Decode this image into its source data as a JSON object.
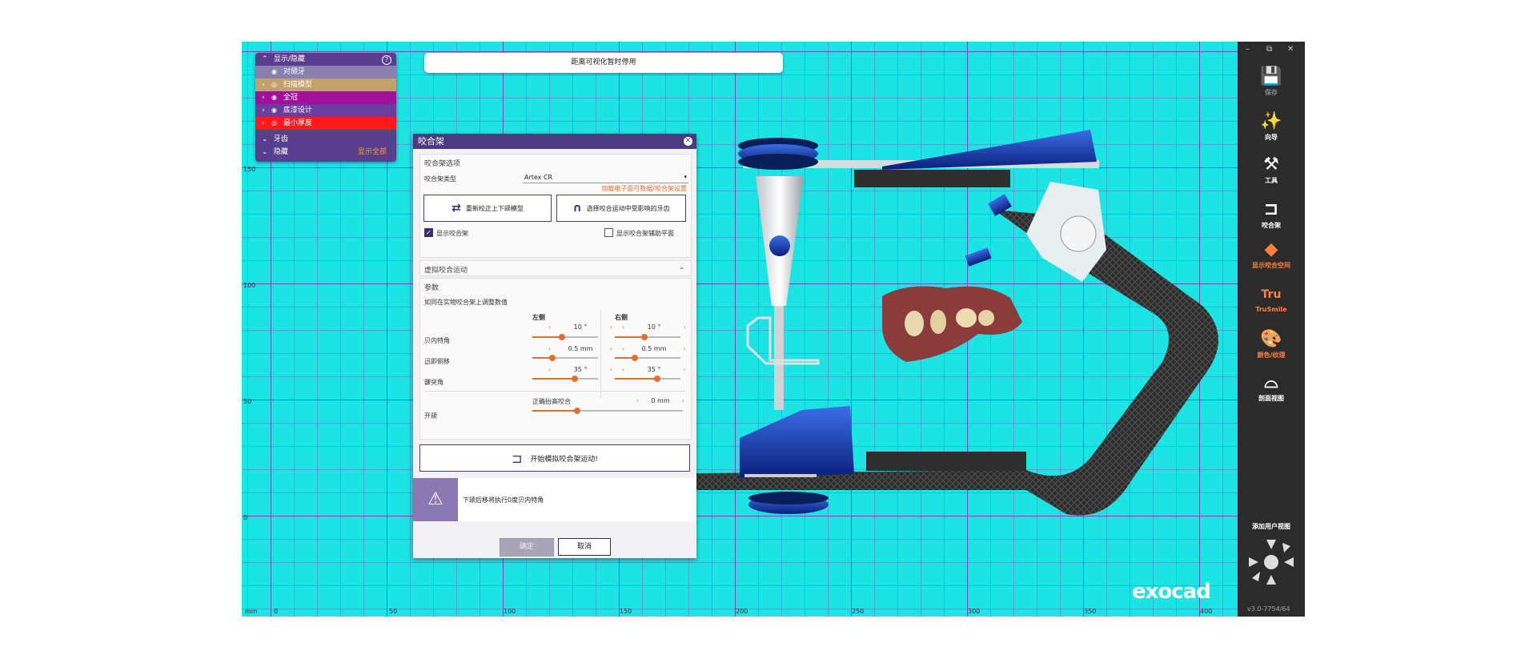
{
  "visibility_panel": {
    "title": "显示/隐藏",
    "rows": [
      {
        "label": "对颌牙",
        "color": "#8a80b0"
      },
      {
        "label": "扫描模型",
        "color": "#c4a06a"
      },
      {
        "label": "全冠",
        "color": "#a0109a"
      },
      {
        "label": "底漆设计",
        "color": "#6a3e9e"
      },
      {
        "label": "最小厚度",
        "color": "#ff1a1a"
      }
    ],
    "teeth_label": "牙齿",
    "hidden_label": "隐藏",
    "show_all_label": "显示全部"
  },
  "banner": {
    "text": "距离可视化暂时停用"
  },
  "dialog": {
    "title": "咬合架",
    "options_section": "咬合架选项",
    "type_label": "咬合架类型",
    "type_value": "Artex CR",
    "load_link": "加载电子面弓数据/咬合架设置",
    "recalibrate_button": "重新校正上下颌模型",
    "select_teeth_button": "选择咬合运动中受影响的牙齿",
    "show_articulator_label": "显示咬合架",
    "show_articulator_checked": true,
    "show_aux_plane_label": "显示咬合架辅助平面",
    "show_aux_plane_checked": false,
    "virtual_motion_section": "虚拟咬合运动",
    "params_section": "参数",
    "params_hint": "如同在实物咬合架上调整数值",
    "left_label": "左侧",
    "right_label": "右侧",
    "bennett_label": "贝内特角",
    "bennett_left": "10 °",
    "bennett_right": "10 °",
    "bennett_left_frac": 0.45,
    "bennett_right_frac": 0.45,
    "shift_label": "迅即侧移",
    "shift_left": "0.5 mm",
    "shift_right": "0.5 mm",
    "shift_left_frac": 0.3,
    "shift_right_frac": 0.3,
    "condyle_label": "髁突角",
    "condyle_left": "35 °",
    "condyle_right": "35 °",
    "condyle_left_frac": 0.65,
    "condyle_right_frac": 0.65,
    "opening_label": "开颌",
    "centric_label": "正确抬高咬合",
    "centric_value": "0 mm",
    "centric_frac": 0.3,
    "start_button": "开始模拟咬合架运动!",
    "warning_text": "下颌后移将执行0度贝内特角",
    "ok_button": "确定",
    "cancel_button": "取消"
  },
  "sidebar": {
    "tools": [
      {
        "label": "保存",
        "icon": "save-icon",
        "color": "#8a8a8a",
        "glyph": "💾"
      },
      {
        "label": "向导",
        "icon": "wizard-icon",
        "color": "#ffffff",
        "glyph": "✨"
      },
      {
        "label": "工具",
        "icon": "tools-icon",
        "color": "#ffffff",
        "glyph": "⚒"
      },
      {
        "label": "咬合架",
        "icon": "articulator-icon",
        "color": "#ffffff",
        "glyph": "⊐"
      },
      {
        "label": "显示咬合空间",
        "icon": "occlusal-space-icon",
        "color": "#ff8040",
        "glyph": "◆"
      },
      {
        "label": "TruSmile",
        "icon": "trusmile-icon",
        "color": "#ff8040",
        "glyph": "Tru"
      },
      {
        "label": "颜色/纹理",
        "icon": "palette-icon",
        "color": "#ff8040",
        "glyph": "🎨"
      },
      {
        "label": "剖面视图",
        "icon": "cross-section-icon",
        "color": "#ffffff",
        "glyph": "⌓"
      }
    ],
    "add_view_label": "添加用户视图",
    "version": "v3.0-7754/64"
  },
  "ruler": {
    "x_ticks": [
      "mm",
      "0",
      "50",
      "100",
      "150",
      "200",
      "250",
      "300",
      "350",
      "400"
    ],
    "y_ticks": [
      "150",
      "100",
      "50",
      "0"
    ]
  },
  "logo": "exocad"
}
